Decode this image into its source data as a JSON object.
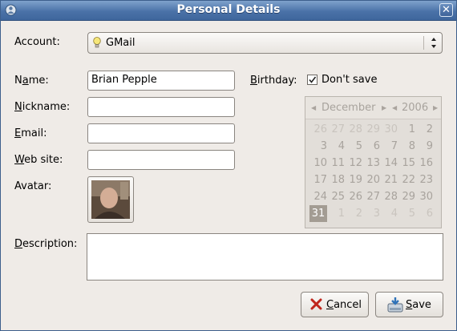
{
  "window": {
    "title": "Personal Details",
    "close_symbol": "✕"
  },
  "account": {
    "label": "Account:",
    "value": "GMail",
    "icon": "lightbulb-icon"
  },
  "fields": {
    "name_label": "Name:",
    "name_value": "Brian Pepple",
    "nickname_label": "Nickname:",
    "nickname_value": "",
    "email_label": "Email:",
    "email_value": "",
    "website_label": "Web site:",
    "website_value": "",
    "avatar_label": "Avatar:",
    "description_label": "Description:",
    "description_value": ""
  },
  "birthday": {
    "label": "Birthday:",
    "dont_save_label": "Don't save",
    "dont_save_checked": true,
    "calendar": {
      "month": "December",
      "year": "2006",
      "selected_day": "31",
      "weeks": [
        [
          "26",
          "27",
          "28",
          "29",
          "30",
          "1",
          "2"
        ],
        [
          "3",
          "4",
          "5",
          "6",
          "7",
          "8",
          "9"
        ],
        [
          "10",
          "11",
          "12",
          "13",
          "14",
          "15",
          "16"
        ],
        [
          "17",
          "18",
          "19",
          "20",
          "21",
          "22",
          "23"
        ],
        [
          "24",
          "25",
          "26",
          "27",
          "28",
          "29",
          "30"
        ],
        [
          "31",
          "1",
          "2",
          "3",
          "4",
          "5",
          "6"
        ]
      ]
    }
  },
  "buttons": {
    "cancel_label": "Cancel",
    "save_label": "Save"
  }
}
